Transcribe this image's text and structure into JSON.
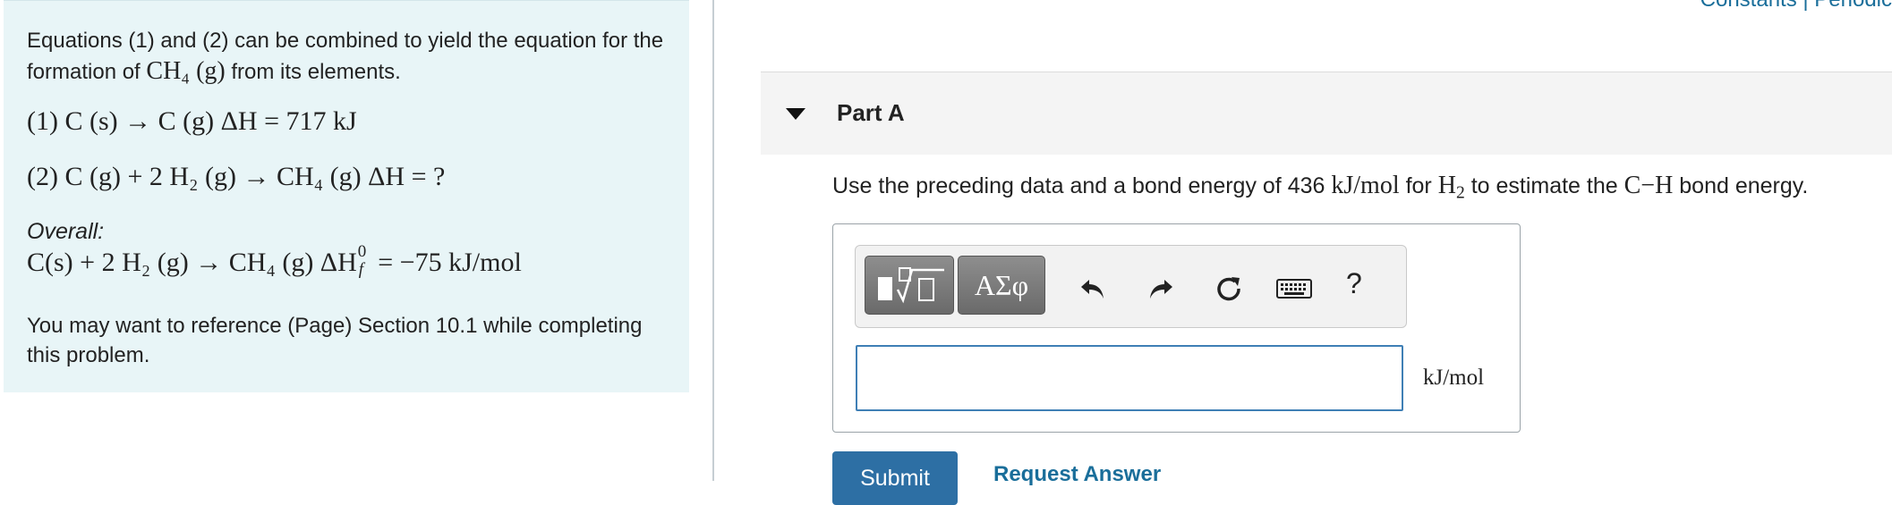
{
  "left_panel": {
    "intro": {
      "text_before": "Equations (1) and (2) can be combined to yield the equation for the formation of",
      "formula": "CH₄ (g)",
      "text_after": "from its elements."
    },
    "equation_1": "(1)   C (s) → C (g)   ΔH  =  717 kJ",
    "equation_2": "(2)   C (g) + 2 H₂ (g) → CH₄ (g)   ΔH  = ?",
    "overall_label": "Overall:",
    "overall_equation": "C(s) + 2 H₂ (g) → CH₄ (g)   ΔH",
    "overall_sup": "0",
    "overall_sub": "f",
    "overall_value": "  =  −75 kJ/mol",
    "reference_text": "You may want to reference (Page) Section 10.1 while completing this problem."
  },
  "header_links": "Constants | Periodic",
  "part": {
    "title": "Part A"
  },
  "question": {
    "text_1": "Use the preceding data and a bond energy of 436",
    "unit_1": "kJ/mol",
    "text_2": "for",
    "h2_base": "H",
    "h2_sub": "2",
    "text_3": "to estimate the",
    "bond": "C−H",
    "text_4": "bond energy."
  },
  "toolbar": {
    "greek_label": "ΑΣφ",
    "help_label": "?",
    "icons": [
      "templates-icon",
      "undo-icon",
      "redo-icon",
      "reset-icon",
      "keyboard-icon",
      "help-icon"
    ]
  },
  "answer": {
    "value": "",
    "unit": "kJ/mol"
  },
  "actions": {
    "submit_label": "Submit",
    "request_label": "Request Answer"
  },
  "colors": {
    "panel_bg": "#e8f5f7",
    "link": "#1a6e9a",
    "submit_bg": "#2d6fa4",
    "input_border": "#3f7fb5"
  }
}
